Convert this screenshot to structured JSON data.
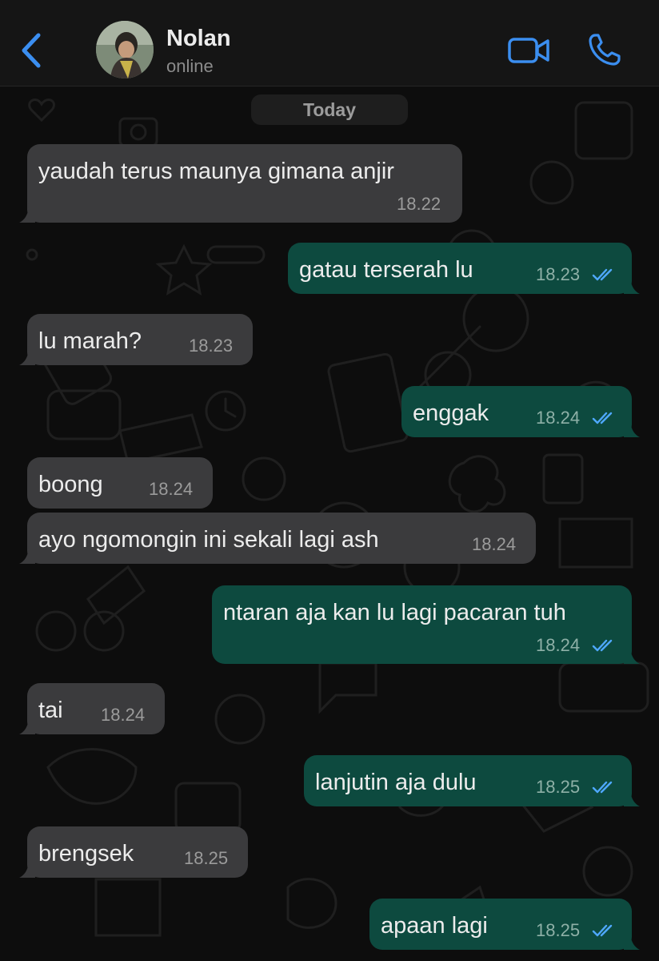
{
  "header": {
    "contact_name": "Nolan",
    "status": "online",
    "accent_color": "#3b8ef0"
  },
  "chat": {
    "date_separator": "Today",
    "messages": [
      {
        "direction": "in",
        "text": "yaudah terus maunya gimana anjir",
        "time": "18.22"
      },
      {
        "direction": "out",
        "text": "gatau terserah lu",
        "time": "18.23",
        "status": "read"
      },
      {
        "direction": "in",
        "text": "lu marah?",
        "time": "18.23"
      },
      {
        "direction": "out",
        "text": "enggak",
        "time": "18.24",
        "status": "read"
      },
      {
        "direction": "in",
        "text": "boong",
        "time": "18.24"
      },
      {
        "direction": "in",
        "text": "ayo ngomongin ini sekali lagi ash",
        "time": "18.24"
      },
      {
        "direction": "out",
        "text": "ntaran aja kan lu lagi pacaran tuh",
        "time": "18.24",
        "status": "read"
      },
      {
        "direction": "in",
        "text": "tai",
        "time": "18.24"
      },
      {
        "direction": "out",
        "text": "lanjutin aja dulu",
        "time": "18.25",
        "status": "read"
      },
      {
        "direction": "in",
        "text": "brengsek",
        "time": "18.25"
      },
      {
        "direction": "out",
        "text": "apaan lagi",
        "time": "18.25",
        "status": "read"
      }
    ]
  },
  "colors": {
    "incoming_bubble": "#3b3b3d",
    "outgoing_bubble": "#0d4a3f",
    "read_ticks": "#4fa8ff"
  }
}
